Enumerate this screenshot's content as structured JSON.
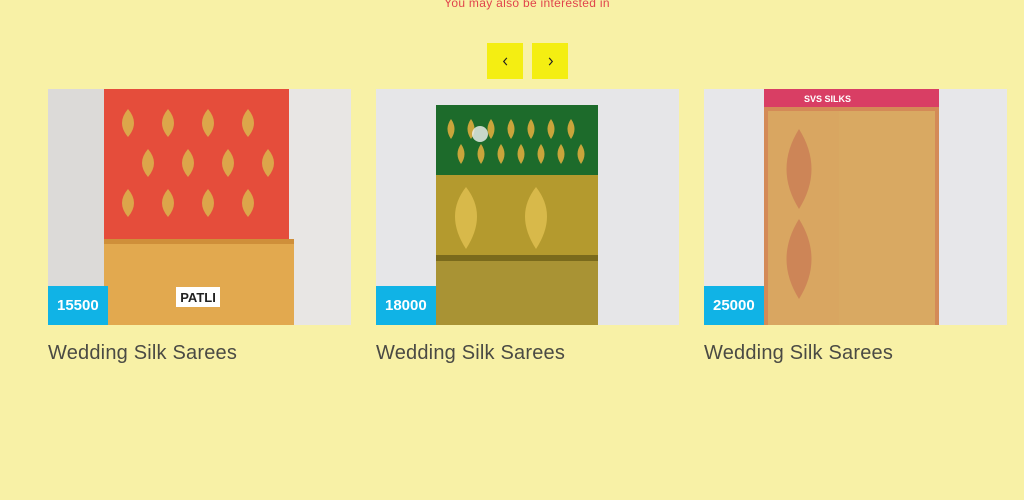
{
  "section": {
    "heading": "You may also be interested in"
  },
  "nav": {
    "prev_icon": "chevron-left-icon",
    "next_icon": "chevron-right-icon"
  },
  "products": [
    {
      "price": "15500",
      "title": "Wedding Silk Sarees",
      "tag": "PATLI",
      "colors": {
        "body": "#e54d3b",
        "motif": "#dca64a",
        "border": "#e2a94f"
      }
    },
    {
      "price": "18000",
      "title": "Wedding Silk Sarees",
      "colors": {
        "body": "#1d6b2b",
        "motif": "#c9a53b",
        "border": "#a99334"
      }
    },
    {
      "price": "25000",
      "title": "Wedding Silk Sarees",
      "logo": "SVS SILKS",
      "colors": {
        "body": "#d48a57",
        "motif": "#c9a055",
        "border": "#d93e64"
      }
    }
  ],
  "theme": {
    "background": "#f8f1a6",
    "accent": "#f4ee12",
    "badge": "#10b3e6",
    "heading": "#e0444c"
  }
}
